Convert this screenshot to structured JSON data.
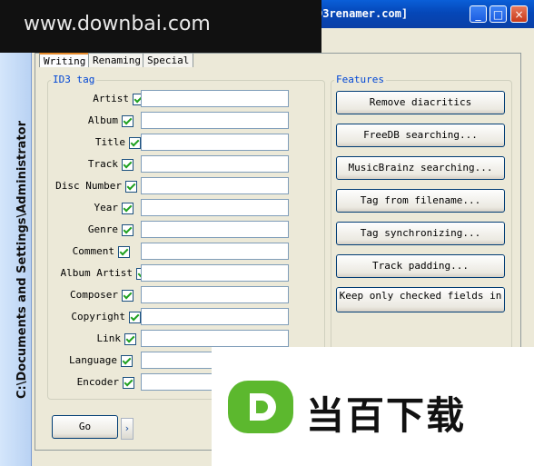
{
  "window": {
    "title_fragment": "D3renamer.com]",
    "buttons": {
      "minimize": "_",
      "maximize": "□",
      "close": "×"
    }
  },
  "watermark_top": "www.downbai.com",
  "watermark_bottom": "当百下载",
  "sidebar": {
    "path": "C:\\Documents and Settings\\Administrator"
  },
  "tabs": [
    {
      "label": "Writing"
    },
    {
      "label": "Renaming"
    },
    {
      "label": "Special"
    }
  ],
  "id3": {
    "title": "ID3 tag",
    "fields": [
      {
        "label": "Artist",
        "checked": true,
        "value": ""
      },
      {
        "label": "Album",
        "checked": true,
        "value": ""
      },
      {
        "label": "Title",
        "checked": true,
        "value": ""
      },
      {
        "label": "Track",
        "checked": true,
        "value": ""
      },
      {
        "label": "Disc Number",
        "checked": true,
        "value": ""
      },
      {
        "label": "Year",
        "checked": true,
        "value": ""
      },
      {
        "label": "Genre",
        "checked": true,
        "value": ""
      },
      {
        "label": "Comment",
        "checked": true,
        "value": ""
      },
      {
        "label": "Album Artist",
        "checked": true,
        "value": ""
      },
      {
        "label": "Composer",
        "checked": true,
        "value": ""
      },
      {
        "label": "Copyright",
        "checked": true,
        "value": ""
      },
      {
        "label": "Link",
        "checked": true,
        "value": ""
      },
      {
        "label": "Language",
        "checked": true,
        "value": ""
      },
      {
        "label": "Encoder",
        "checked": true,
        "value": ""
      }
    ]
  },
  "features": {
    "title": "Features",
    "buttons": [
      {
        "label": "Remove diacritics"
      },
      {
        "label": "FreeDB searching..."
      },
      {
        "label": "MusicBrainz searching..."
      },
      {
        "label": "Tag from filename..."
      },
      {
        "label": "Tag synchronizing..."
      },
      {
        "label": "Track padding..."
      },
      {
        "label": "Keep only checked fields in"
      }
    ]
  },
  "go_button": {
    "label": "Go",
    "arrow": "›"
  },
  "colors": {
    "titlebar": "#0547b8",
    "group_title": "#0046d5",
    "check": "#21a121",
    "logo_green": "#5cb82e"
  }
}
